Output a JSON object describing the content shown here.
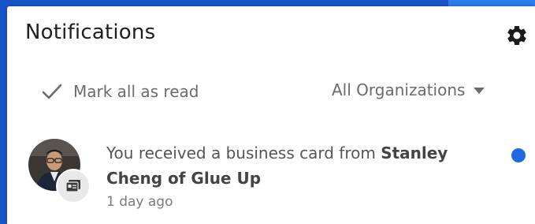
{
  "header": {
    "title": "Notifications",
    "settings_icon": "gear-icon"
  },
  "toolbar": {
    "mark_all_read_label": "Mark all as read",
    "mark_all_read_icon": "checkmark-icon",
    "org_filter": {
      "selected": "All Organizations",
      "icon": "caret-down-icon"
    }
  },
  "notifications": [
    {
      "text_prefix": "You received a business card from ",
      "sender": "Stanley Cheng",
      "text_middle": " of ",
      "organization": "Glue Up",
      "time": "1 day ago",
      "unread": true,
      "badge_icon": "business-card-icon"
    }
  ],
  "colors": {
    "accent": "#1f6ae0",
    "background": "#1756c9",
    "panel": "#ffffff",
    "muted_text": "#6b6b6b"
  }
}
